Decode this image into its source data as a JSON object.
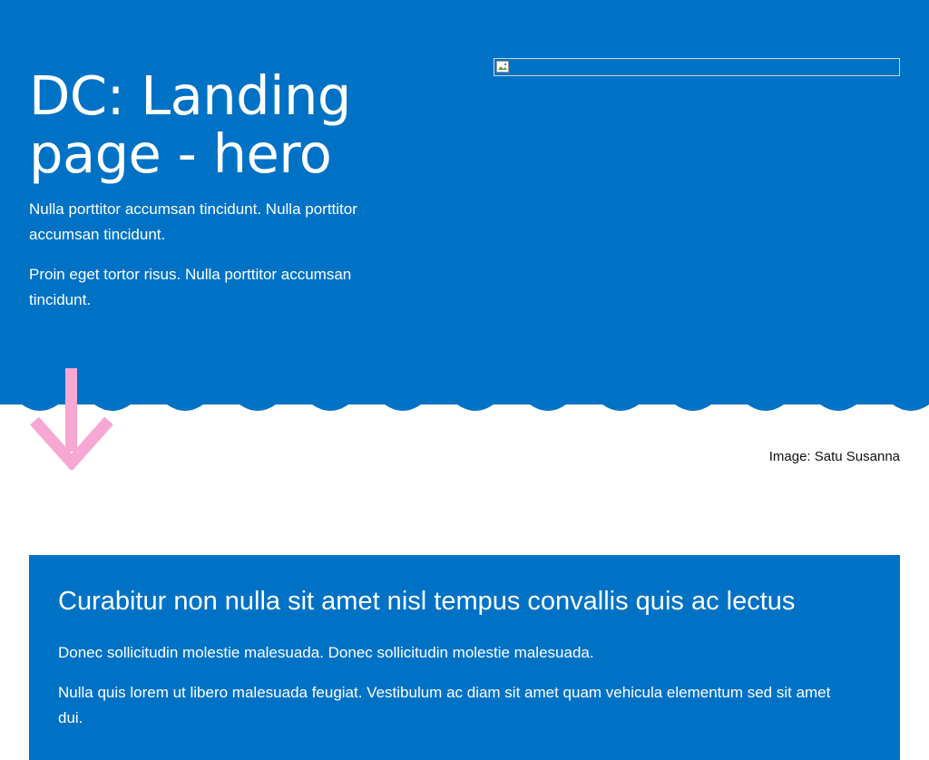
{
  "hero": {
    "title": "DC: Landing page - hero",
    "paragraphs": [
      "Nulla porttitor accumsan tincidunt. Nulla porttitor accumsan tincidunt.",
      "Proin eget tortor risus. Nulla porttitor accumsan tincidunt."
    ],
    "image_icon": "broken-image-icon",
    "arrow_icon": "arrow-down-icon",
    "caption": "Image: Satu Susanna"
  },
  "callout": {
    "title": "Curabitur non nulla sit amet nisl tempus convallis quis ac lectus",
    "paragraphs": [
      "Donec sollicitudin molestie malesuada. Donec sollicitudin molestie malesuada.",
      "Nulla quis lorem ut libero malesuada feugiat. Vestibulum ac diam sit amet quam vehicula elementum sed sit amet dui."
    ]
  },
  "colors": {
    "brand_blue": "#0072c6",
    "arrow_pink": "#f7a8d2",
    "text_on_blue": "#ffffff",
    "text_dark": "#111111"
  }
}
